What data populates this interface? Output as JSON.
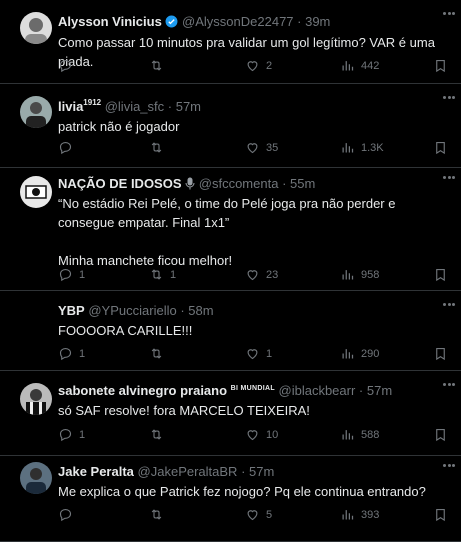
{
  "tweets": [
    {
      "name": "Alysson Vinicius",
      "verified": true,
      "handle": "@AlyssonDe22477",
      "time": "· 39m",
      "text": "Como passar 10 minutos pra validar um gol legítimo? VAR é uma piada.",
      "replies": "",
      "retweets": "",
      "likes": "2",
      "views": "442",
      "avatar_color": "#6b6b6b"
    },
    {
      "name": "livia",
      "name_suffix": "1912",
      "handle": "@livia_sfc",
      "time": "· 57m",
      "text": "patrick não é jogador",
      "replies": "",
      "retweets": "",
      "likes": "35",
      "views": "1.3K",
      "avatar_color": "#4a4a4a"
    },
    {
      "name": "NAÇÃO DE IDOSOS",
      "name_icon": "microphone-icon",
      "handle": "@sfccomenta",
      "time": "· 55m",
      "text": "“No estádio Rei Pelé, o time do Pelé joga pra não perder e consegue empatar. Final 1x1”\n\nMinha manchete ficou melhor!",
      "replies": "1",
      "retweets": "1",
      "likes": "23",
      "views": "958",
      "avatar_color": "#e8e8e8"
    },
    {
      "name": "YBP",
      "handle": "@YPucciariello",
      "time": "· 58m",
      "text": "FOOOORA CARILLE!!!",
      "replies": "1",
      "retweets": "",
      "likes": "1",
      "views": "290",
      "avatar_color": "#000000"
    },
    {
      "name": "sabonete alvinegro praiano",
      "name_badge": "BI MUNDIAL",
      "handle": "@iblackbearr",
      "time": "· 57m",
      "text": "só SAF resolve! fora MARCELO TEIXEIRA!",
      "replies": "1",
      "retweets": "",
      "likes": "10",
      "views": "588",
      "avatar_color": "#3a3a3a"
    },
    {
      "name": "Jake Peralta",
      "handle": "@JakePeraltaBR",
      "time": "· 57m",
      "text": "Me explica o que Patrick fez nojogo? Pq ele continua entrando?",
      "replies": "",
      "retweets": "",
      "likes": "5",
      "views": "393",
      "avatar_color": "#2f4a5a"
    }
  ],
  "colors": {
    "background": "#000000",
    "text": "#e7e9ea",
    "muted": "#71767b",
    "verified": "#1d9bf0",
    "border": "#2f3336"
  }
}
